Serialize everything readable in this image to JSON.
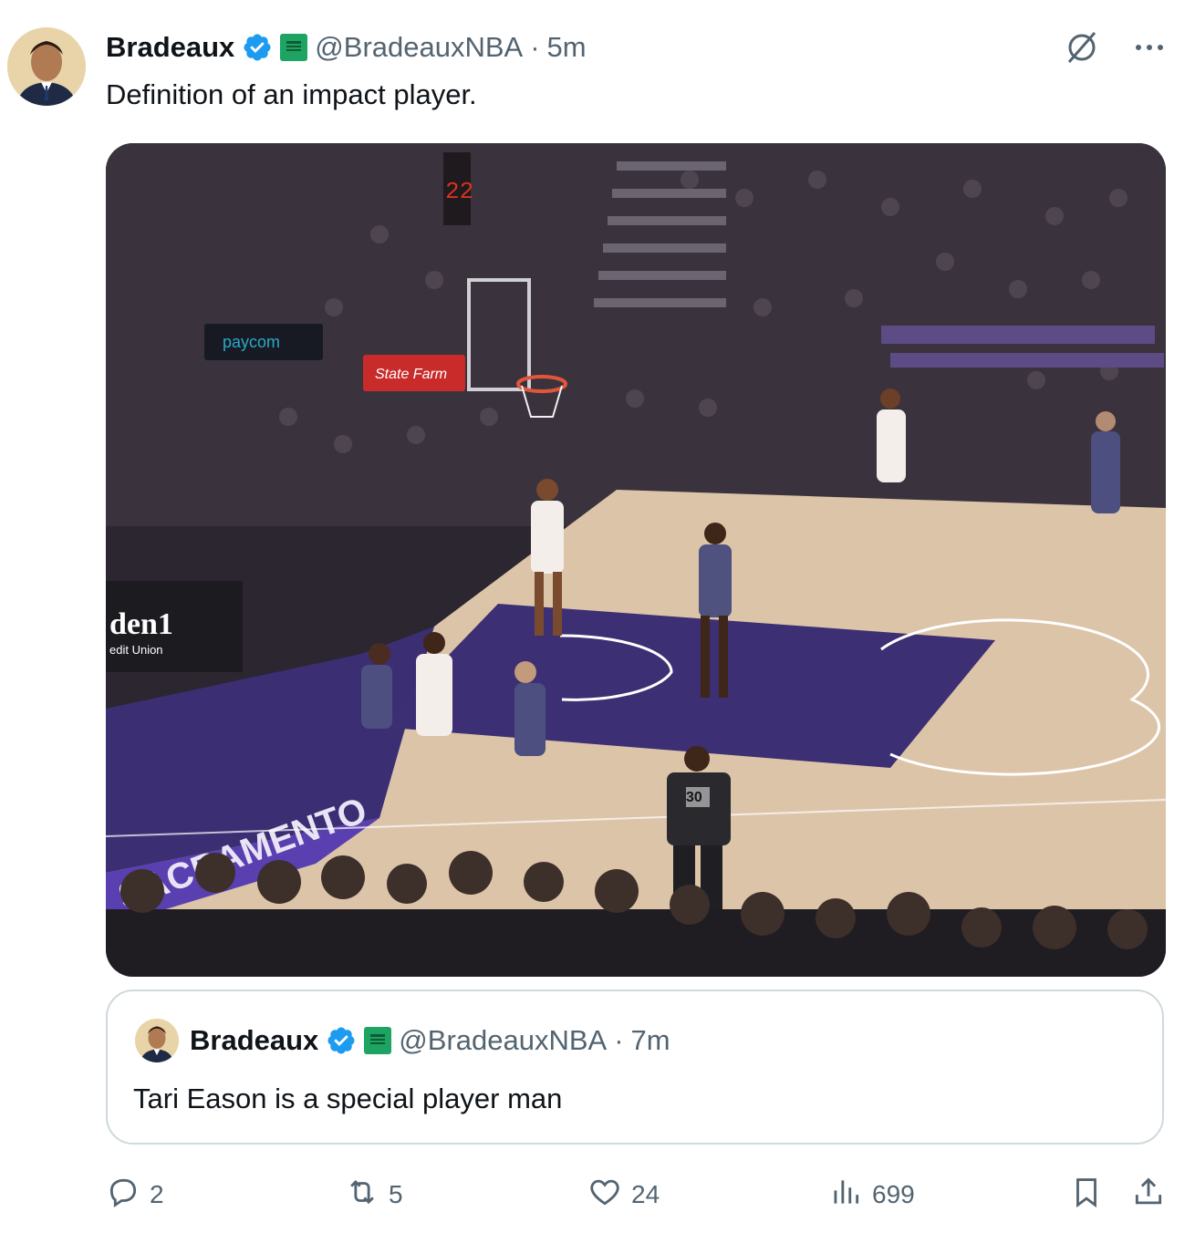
{
  "tweet": {
    "author_name": "Bradeaux",
    "handle": "@BradeauxNBA",
    "separator": "·",
    "time": "5m",
    "text": "Definition of an impact player.",
    "affiliate_badge": "Kaplan Sports",
    "media_alt": "Basketball game video frame"
  },
  "media_scene": {
    "court_sign": "SACRAMENTO",
    "sponsor_1": "paycom",
    "sponsor_2": "State Farm",
    "arena_sign": "den1",
    "arena_sign_sub": "edit Union",
    "shot_clock": "22",
    "referee_number": "30"
  },
  "quoted": {
    "author_name": "Bradeaux",
    "handle": "@BradeauxNBA",
    "separator": "·",
    "time": "7m",
    "text": "Tari Eason is a special player man"
  },
  "actions": {
    "replies": "2",
    "reposts": "5",
    "likes": "24",
    "views": "699"
  },
  "colors": {
    "verified": "#1d9bf0",
    "secondary_text": "#536471",
    "affiliate": "#1da462"
  },
  "icons": [
    "grok-icon",
    "more-icon",
    "verified-badge-icon",
    "reply-icon",
    "repost-icon",
    "like-icon",
    "views-icon",
    "bookmark-icon",
    "share-icon"
  ]
}
